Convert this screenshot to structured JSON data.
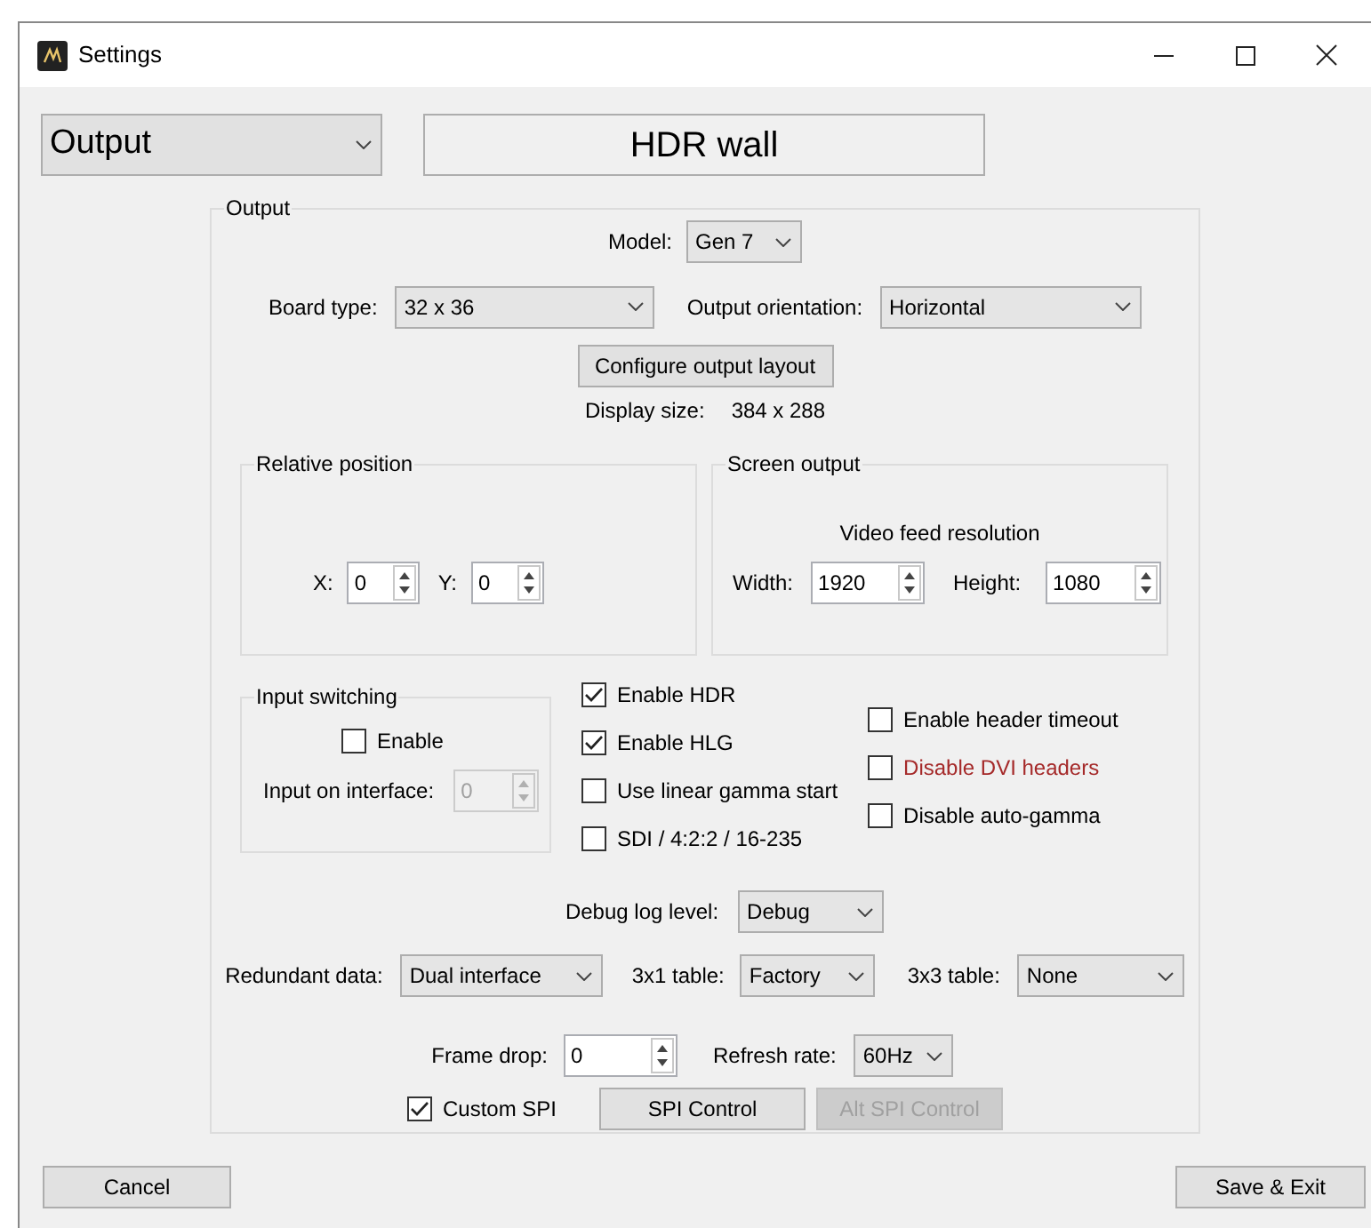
{
  "window": {
    "title": "Settings"
  },
  "page_select": {
    "value": "Output"
  },
  "device_name": "HDR wall",
  "output_group": {
    "title": "Output",
    "model": {
      "label": "Model:",
      "value": "Gen 7"
    },
    "board_type": {
      "label": "Board type:",
      "value": "32 x 36"
    },
    "output_orientation": {
      "label": "Output orientation:",
      "value": "Horizontal"
    },
    "configure_button": "Configure output layout",
    "display_size": {
      "label": "Display size:",
      "value": "384 x 288"
    },
    "relative_position": {
      "title": "Relative position",
      "x": {
        "label": "X:",
        "value": "0"
      },
      "y": {
        "label": "Y:",
        "value": "0"
      }
    },
    "screen_output": {
      "title": "Screen output",
      "subtitle": "Video feed resolution",
      "width": {
        "label": "Width:",
        "value": "1920"
      },
      "height": {
        "label": "Height:",
        "value": "1080"
      }
    },
    "input_switching": {
      "title": "Input switching",
      "enable": {
        "label": "Enable",
        "checked": false
      },
      "input_on_interface": {
        "label": "Input on interface:",
        "value": "0",
        "disabled": true
      }
    },
    "options_left": [
      {
        "label": "Enable HDR",
        "checked": true,
        "color": "#000000"
      },
      {
        "label": "Enable HLG",
        "checked": true,
        "color": "#000000"
      },
      {
        "label": "Use linear gamma start",
        "checked": false,
        "color": "#000000"
      },
      {
        "label": "SDI / 4:2:2 / 16-235",
        "checked": false,
        "color": "#000000"
      }
    ],
    "options_right": [
      {
        "label": "Enable header timeout",
        "checked": false,
        "color": "#000000"
      },
      {
        "label": "Disable DVI headers",
        "checked": false,
        "color": "#a52a2a"
      },
      {
        "label": "Disable auto-gamma",
        "checked": false,
        "color": "#000000"
      }
    ],
    "debug_log_level": {
      "label": "Debug log level:",
      "value": "Debug"
    },
    "redundant_data": {
      "label": "Redundant data:",
      "value": "Dual interface"
    },
    "table_3x1": {
      "label": "3x1 table:",
      "value": "Factory"
    },
    "table_3x3": {
      "label": "3x3 table:",
      "value": "None"
    },
    "frame_drop": {
      "label": "Frame drop:",
      "value": "0"
    },
    "refresh_rate": {
      "label": "Refresh rate:",
      "value": "60Hz"
    },
    "custom_spi": {
      "label": "Custom SPI",
      "checked": true
    },
    "spi_control_button": {
      "label": "SPI Control",
      "disabled": false
    },
    "alt_spi_control_button": {
      "label": "Alt SPI Control",
      "disabled": true
    }
  },
  "cancel_button": "Cancel",
  "save_button": "Save & Exit"
}
